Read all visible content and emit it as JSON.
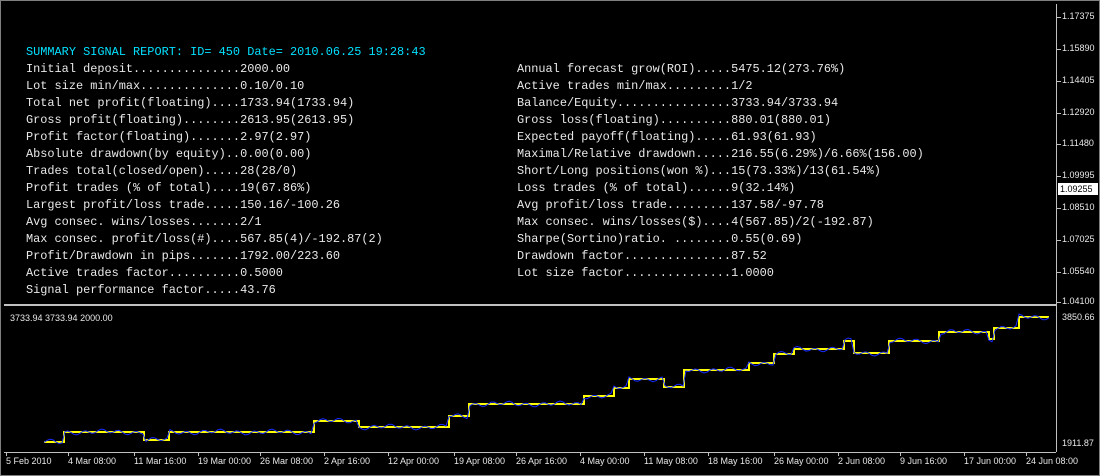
{
  "report": {
    "header": "SUMMARY SIGNAL REPORT: ID= 450 Date= 2010.06.25 19:28:43",
    "left": [
      "Initial deposit...............2000.00",
      "Lot size min/max..............0.10/0.10",
      "Total net profit(floating)....1733.94(1733.94)",
      "Gross profit(floating)........2613.95(2613.95)",
      "Profit factor(floating).......2.97(2.97)",
      "Absolute drawdown(by equity)..0.00(0.00)",
      "Trades total(closed/open).....28(28/0)",
      "Profit trades (% of total)....19(67.86%)",
      "Largest profit/loss trade.....150.16/-100.26",
      "Avg consec. wins/losses.......2/1",
      "Max consec. profit/loss(#)....567.85(4)/-192.87(2)",
      "Profit/Drawdown in pips.......1792.00/223.60",
      "Active trades factor..........0.5000",
      "Signal performance factor.....43.76"
    ],
    "right": [
      "Annual forecast grow(ROI).....5475.12(273.76%)",
      "Active trades min/max.........1/2",
      "Balance/Equity................3733.94/3733.94",
      "Gross loss(floating)..........880.01(880.01)",
      "Expected payoff(floating).....61.93(61.93)",
      "Maximal/Relative drawdown.....216.55(6.29%)/6.66%(156.00)",
      "Short/Long positions(won %)...15(73.33%)/13(61.54%)",
      "Loss trades (% of total)......9(32.14%)",
      "Avg profit/loss trade.........137.58/-97.78",
      "Max consec. wins/losses($)....4(567.85)/2(-192.87)",
      "Sharpe(Sortino)ratio. ........0.55(0.69)",
      "Drawdown factor...............87.52",
      "Lot size factor...............1.0000"
    ]
  },
  "price_axis": {
    "ticks": [
      "1.17375",
      "1.15890",
      "1.14405",
      "1.12920",
      "1.11480",
      "1.09995",
      "1.08510",
      "1.07025",
      "1.05540",
      "1.04100"
    ],
    "current_price": "1.09255"
  },
  "equity_pane": {
    "info": "3733.94 3733.94 2000.00",
    "axis_high": "3850.66",
    "axis_low": "1911.87",
    "colors": {
      "balance": "#ffff00",
      "equity": "#1a2cff",
      "axis": "#c0c0c0"
    }
  },
  "time_axis": {
    "labels": [
      "5 Feb 2010",
      "4 Mar 08:00",
      "11 Mar 16:00",
      "19 Mar 00:00",
      "26 Mar 08:00",
      "2 Apr 16:00",
      "12 Apr 00:00",
      "19 Apr 08:00",
      "26 Apr 16:00",
      "4 May 00:00",
      "11 May 08:00",
      "18 May 16:00",
      "26 May 00:00",
      "2 Jun 08:00",
      "9 Jun 16:00",
      "17 Jun 00:00",
      "24 Jun 08:00"
    ]
  }
}
